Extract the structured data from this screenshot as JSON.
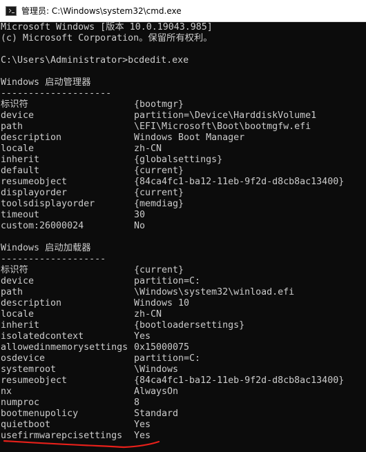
{
  "window": {
    "title": "管理员: C:\\Windows\\system32\\cmd.exe"
  },
  "header": {
    "line1": "Microsoft Windows [版本 10.0.19043.985]",
    "line2": "(c) Microsoft Corporation。保留所有权利。",
    "prompt": "C:\\Users\\Administrator>bcdedit.exe"
  },
  "boot_manager": {
    "heading": "Windows 启动管理器",
    "separator": "--------------------",
    "entries": [
      {
        "key": "标识符",
        "value": "{bootmgr}"
      },
      {
        "key": "device",
        "value": "partition=\\Device\\HarddiskVolume1"
      },
      {
        "key": "path",
        "value": "\\EFI\\Microsoft\\Boot\\bootmgfw.efi"
      },
      {
        "key": "description",
        "value": "Windows Boot Manager"
      },
      {
        "key": "locale",
        "value": "zh-CN"
      },
      {
        "key": "inherit",
        "value": "{globalsettings}"
      },
      {
        "key": "default",
        "value": "{current}"
      },
      {
        "key": "resumeobject",
        "value": "{84ca4fc1-ba12-11eb-9f2d-d8cb8ac13400}"
      },
      {
        "key": "displayorder",
        "value": "{current}"
      },
      {
        "key": "toolsdisplayorder",
        "value": "{memdiag}"
      },
      {
        "key": "timeout",
        "value": "30"
      },
      {
        "key": "custom:26000024",
        "value": "No"
      }
    ]
  },
  "boot_loader": {
    "heading": "Windows 启动加载器",
    "separator": "-------------------",
    "entries": [
      {
        "key": "标识符",
        "value": "{current}"
      },
      {
        "key": "device",
        "value": "partition=C:"
      },
      {
        "key": "path",
        "value": "\\Windows\\system32\\winload.efi"
      },
      {
        "key": "description",
        "value": "Windows 10"
      },
      {
        "key": "locale",
        "value": "zh-CN"
      },
      {
        "key": "inherit",
        "value": "{bootloadersettings}"
      },
      {
        "key": "isolatedcontext",
        "value": "Yes"
      },
      {
        "key": "allowedinmemorysettings",
        "value": "0x15000075"
      },
      {
        "key": "osdevice",
        "value": "partition=C:"
      },
      {
        "key": "systemroot",
        "value": "\\Windows"
      },
      {
        "key": "resumeobject",
        "value": "{84ca4fc1-ba12-11eb-9f2d-d8cb8ac13400}"
      },
      {
        "key": "nx",
        "value": "AlwaysOn"
      },
      {
        "key": "numproc",
        "value": "8"
      },
      {
        "key": "bootmenupolicy",
        "value": "Standard"
      },
      {
        "key": "quietboot",
        "value": "Yes"
      },
      {
        "key": "usefirmwarepcisettings",
        "value": "Yes"
      }
    ]
  },
  "colors": {
    "console_bg": "#0c0c0c",
    "console_text": "#cccccc",
    "annotation": "#e8201a"
  },
  "icons": {
    "title_icon": "cmd-icon"
  }
}
